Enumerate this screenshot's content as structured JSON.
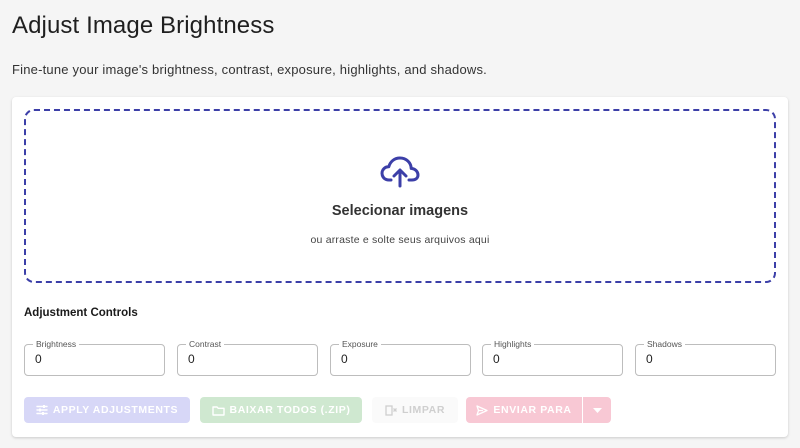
{
  "header": {
    "title": "Adjust Image Brightness",
    "subtitle": "Fine-tune your image's brightness, contrast, exposure, highlights, and shadows."
  },
  "dropzone": {
    "icon": "cloud-upload-icon",
    "title": "Selecionar imagens",
    "subtitle": "ou arraste e solte seus arquivos aqui"
  },
  "controls": {
    "title": "Adjustment Controls",
    "fields": [
      {
        "label": "Brightness",
        "value": "0"
      },
      {
        "label": "Contrast",
        "value": "0"
      },
      {
        "label": "Exposure",
        "value": "0"
      },
      {
        "label": "Highlights",
        "value": "0"
      },
      {
        "label": "Shadows",
        "value": "0"
      }
    ]
  },
  "actions": {
    "apply_label": "APPLY ADJUSTMENTS",
    "zip_label": "BAIXAR TODOS (.ZIP)",
    "clear_label": "LIMPAR",
    "send_label": "ENVIAR PARA"
  },
  "colors": {
    "accent": "#3c3fa8",
    "apply_disabled": "#d7d7f7",
    "zip_disabled": "#cfe8d0",
    "send_disabled": "#f8c8d4"
  }
}
